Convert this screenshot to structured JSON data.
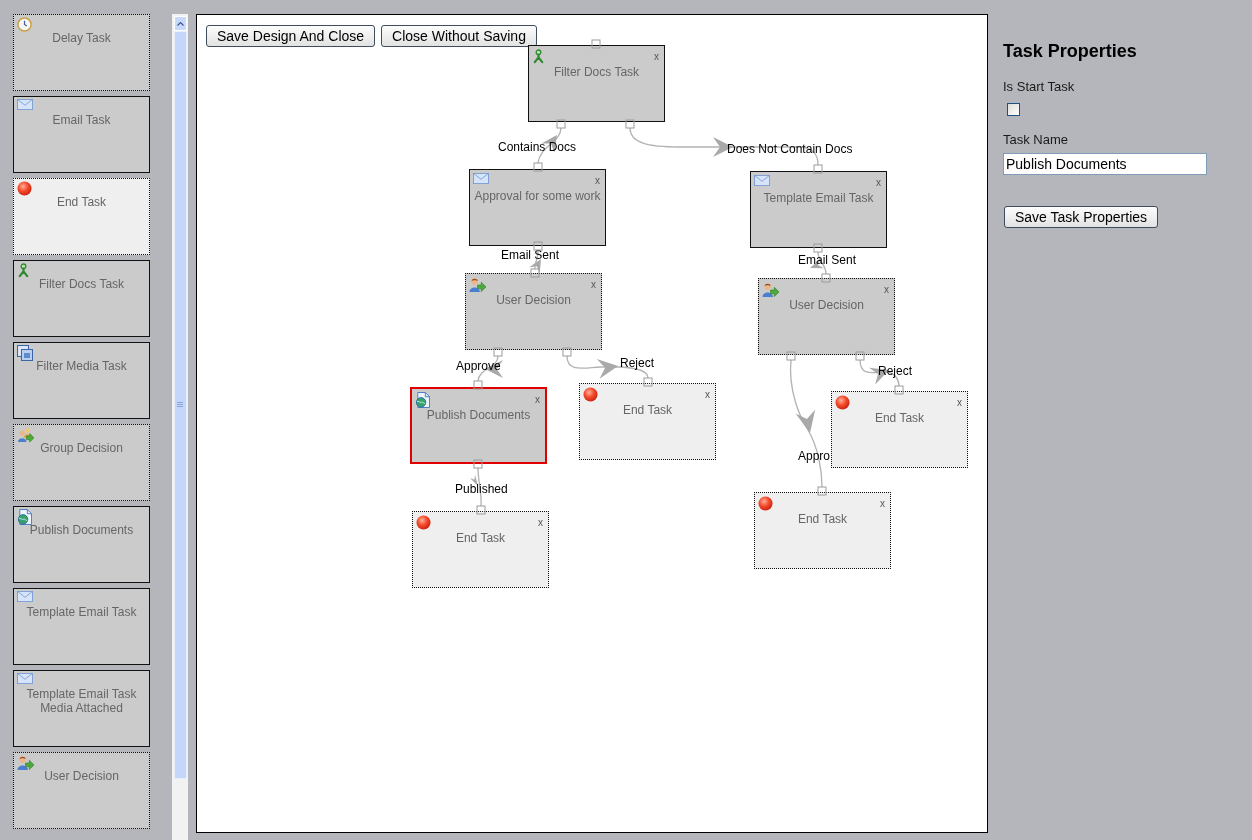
{
  "palette": {
    "items": [
      {
        "label": "Delay Task",
        "kind": "delay"
      },
      {
        "label": "Email Task",
        "kind": "email"
      },
      {
        "label": "End Task",
        "kind": "end"
      },
      {
        "label": "Filter Docs Task",
        "kind": "filter_docs"
      },
      {
        "label": "Filter Media Task",
        "kind": "filter_media"
      },
      {
        "label": "Group Decision",
        "kind": "group_decision"
      },
      {
        "label": "Publish Documents",
        "kind": "publish"
      },
      {
        "label": "Template Email Task",
        "kind": "template_email"
      },
      {
        "label": "Template Email Task Media Attached",
        "kind": "template_email"
      },
      {
        "label": "User Decision",
        "kind": "user_decision"
      }
    ]
  },
  "canvas": {
    "buttons": [
      "Save Design And Close",
      "Close Without Saving"
    ],
    "nodes": [
      {
        "label": "Filter Docs Task",
        "kind": "filter_docs",
        "close": "x",
        "selected": false
      },
      {
        "label": "Approval for some work",
        "kind": "email",
        "close": "x",
        "selected": false
      },
      {
        "label": "Template Email Task",
        "kind": "template_email",
        "close": "x",
        "selected": false
      },
      {
        "label": "User Decision",
        "kind": "user_decision",
        "close": "x",
        "selected": false
      },
      {
        "label": "User Decision",
        "kind": "user_decision",
        "close": "x",
        "selected": false
      },
      {
        "label": "Publish Documents",
        "kind": "publish",
        "close": "x",
        "selected": true
      },
      {
        "label": "End Task",
        "kind": "end",
        "close": "x",
        "selected": false
      },
      {
        "label": "End Task",
        "kind": "end",
        "close": "x",
        "selected": false
      },
      {
        "label": "End Task",
        "kind": "end",
        "close": "x",
        "selected": false
      },
      {
        "label": "End Task",
        "kind": "end",
        "close": "x",
        "selected": false
      }
    ],
    "connections": [
      {
        "label": "Contains Docs"
      },
      {
        "label": "Does Not Contain Docs"
      },
      {
        "label": "Email Sent"
      },
      {
        "label": "Email Sent"
      },
      {
        "label": "Approve"
      },
      {
        "label": "Reject"
      },
      {
        "label": "Reject"
      },
      {
        "label": "Appro"
      },
      {
        "label": "Published"
      }
    ]
  },
  "properties": {
    "title": "Task Properties",
    "start_task": {
      "label": "Is Start Task",
      "checked": false
    },
    "task_name": {
      "label": "Task Name",
      "value": "Publish Documents"
    },
    "button": "Save Task Properties"
  }
}
